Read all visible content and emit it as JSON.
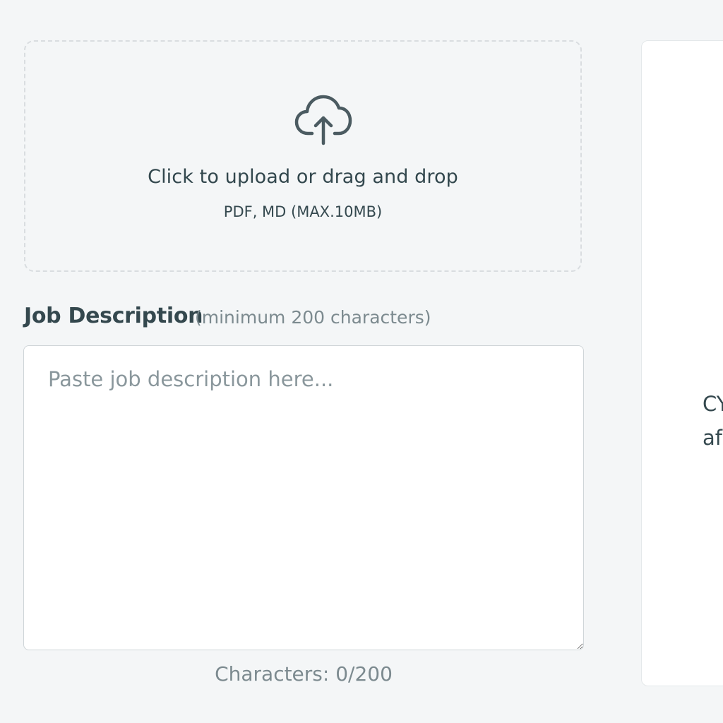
{
  "upload": {
    "icon": "cloud-upload-icon",
    "title": "Click to upload or drag and drop",
    "subtitle": "PDF, MD (MAX.10MB)"
  },
  "job_description": {
    "label": "Job Description",
    "hint": "(minimum 200 characters)",
    "placeholder": "Paste job description here...",
    "value": "",
    "char_count": "Characters: 0/200"
  },
  "preview": {
    "line1": "CY",
    "line2": "af"
  },
  "colors": {
    "background": "#f4f6f7",
    "text_primary": "#34484e",
    "text_muted": "#7c8a8f",
    "dashed_border": "#d9dde0",
    "icon": "#4b5b61"
  }
}
